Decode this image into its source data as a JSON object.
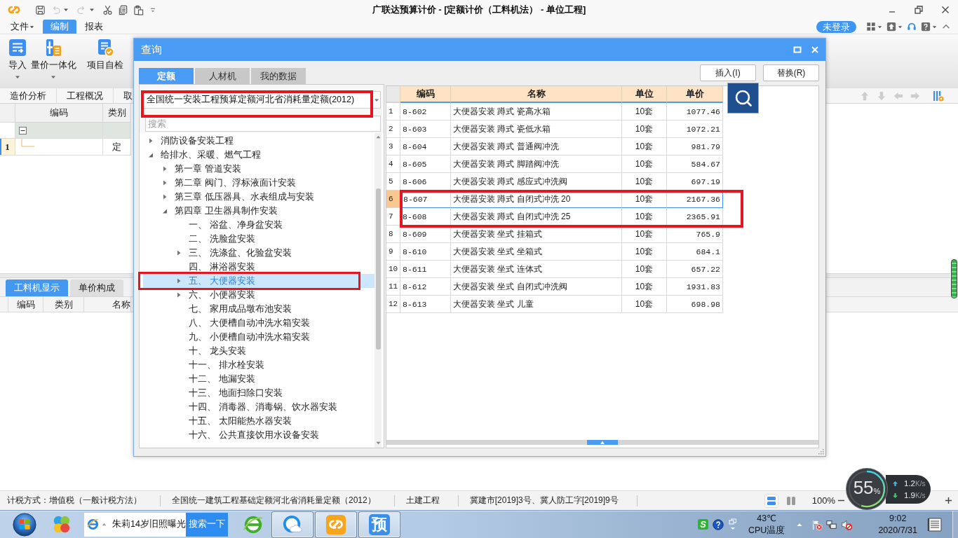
{
  "titlebar": {
    "title": "广联达预算计价 - [定额计价（工料机法） - 单位工程]",
    "quick_access": [
      {
        "kind": "save",
        "disabled": false,
        "menu": false
      },
      {
        "kind": "undo",
        "disabled": true,
        "menu": true
      },
      {
        "kind": "redo",
        "disabled": true,
        "menu": true
      },
      {
        "kind": "cut",
        "disabled": false,
        "menu": false
      },
      {
        "kind": "copy",
        "disabled": false,
        "menu": false
      },
      {
        "kind": "paste",
        "disabled": false,
        "menu": false
      },
      {
        "kind": "customize",
        "disabled": false,
        "menu": false
      }
    ]
  },
  "menu_bar": {
    "items": [
      {
        "label": "文件",
        "menu": true,
        "selected": false
      },
      {
        "label": "编制",
        "menu": false,
        "selected": true
      },
      {
        "label": "报表",
        "menu": false,
        "selected": false
      }
    ],
    "account": "未登录",
    "tools": [
      {
        "kind": "layout",
        "menu": true
      },
      {
        "kind": "upload",
        "menu": true
      },
      {
        "kind": "support",
        "menu": false
      },
      {
        "kind": "help",
        "menu": true
      },
      {
        "kind": "collapse",
        "menu": false
      }
    ]
  },
  "ribbon": [
    {
      "kind": "import",
      "label": "导入",
      "menu": true
    },
    {
      "kind": "pricing",
      "label": "量价一体化",
      "menu": true
    },
    {
      "kind": "check",
      "label": "项目自检",
      "menu": false
    }
  ],
  "view_tabs": [
    "造价分析",
    "工程概况",
    "取"
  ],
  "grid_tools": [
    {
      "kind": "up",
      "disabled": true
    },
    {
      "kind": "down",
      "disabled": true
    },
    {
      "kind": "left",
      "disabled": true
    },
    {
      "kind": "right",
      "disabled": true
    },
    {
      "kind": "settings",
      "disabled": false
    }
  ],
  "grid": {
    "columns": [
      "编码",
      "类别"
    ],
    "rows": [
      {
        "kind": "group",
        "expanded": true,
        "selected": false
      },
      {
        "kind": "item",
        "number": "1",
        "category": "定",
        "selected": true
      }
    ]
  },
  "lower_pane": {
    "tabs": [
      {
        "label": "工料机显示",
        "selected": true
      },
      {
        "label": "单价构成",
        "selected": false
      }
    ],
    "columns": [
      "编码",
      "类别",
      "名称"
    ]
  },
  "dialog": {
    "title": "查询",
    "tabs": [
      {
        "label": "定额",
        "selected": true
      },
      {
        "label": "人材机",
        "selected": false
      },
      {
        "label": "我的数据",
        "selected": false
      }
    ],
    "library": {
      "value": "全国统一安装工程预算定额河北省消耗量定额(2012)",
      "highlighted": true
    },
    "search": {
      "placeholder": "搜索"
    },
    "tree": [
      {
        "label": "消防设备安装工程",
        "expanded": false,
        "selected": false,
        "highlighted": false
      },
      {
        "label": "给排水、采暖、燃气工程",
        "expanded": true,
        "selected": false,
        "highlighted": false,
        "children": [
          {
            "label": "第一章 管道安装",
            "expanded": false,
            "selected": false,
            "highlighted": false
          },
          {
            "label": "第二章 阀门、浮标液面计安装",
            "expanded": false,
            "selected": false,
            "highlighted": false
          },
          {
            "label": "第三章 低压器具、水表组成与安装",
            "expanded": false,
            "selected": false,
            "highlighted": false
          },
          {
            "label": "第四章 卫生器具制作安装",
            "expanded": true,
            "selected": false,
            "highlighted": false,
            "children": [
              {
                "label": "一、 浴盆、净身盆安装",
                "selected": false,
                "highlighted": false
              },
              {
                "label": "二、 洗脸盆安装",
                "selected": false,
                "highlighted": false
              },
              {
                "label": "三、 洗涤盆、化验盆安装",
                "expanded": false,
                "selected": false,
                "highlighted": false
              },
              {
                "label": "四、 淋浴器安装",
                "selected": false,
                "highlighted": false
              },
              {
                "label": "五、 大便器安装",
                "expanded": false,
                "selected": true,
                "highlighted": true
              },
              {
                "label": "六、 小便器安装",
                "expanded": false,
                "selected": false,
                "highlighted": false
              },
              {
                "label": "七、 家用成品墩布池安装",
                "selected": false,
                "highlighted": false
              },
              {
                "label": "八、 大便槽自动冲洗水箱安装",
                "selected": false,
                "highlighted": false
              },
              {
                "label": "九、 小便槽自动冲洗水箱安装",
                "selected": false,
                "highlighted": false
              },
              {
                "label": "十、 龙头安装",
                "selected": false,
                "highlighted": false
              },
              {
                "label": "十一、 排水栓安装",
                "selected": false,
                "highlighted": false
              },
              {
                "label": "十二、 地漏安装",
                "selected": false,
                "highlighted": false
              },
              {
                "label": "十三、 地面扫除口安装",
                "selected": false,
                "highlighted": false
              },
              {
                "label": "十四、 消毒器、消毒锅、饮水器安装",
                "selected": false,
                "highlighted": false
              },
              {
                "label": "十五、 太阳能热水器安装",
                "selected": false,
                "highlighted": false
              },
              {
                "label": "十六、 公共直接饮用水设备安装",
                "selected": false,
                "highlighted": false
              }
            ]
          }
        ]
      }
    ],
    "buttons": [
      "插入(I)",
      "替换(R)"
    ],
    "table": {
      "columns": [
        "编码",
        "名称",
        "单位",
        "单价"
      ],
      "rows": [
        {
          "number": "1",
          "code": "8-602",
          "name": "大便器安装 蹲式 瓷高水箱",
          "unit": "10套",
          "price": "1077.46",
          "selected": false,
          "highlighted": false
        },
        {
          "number": "2",
          "code": "8-603",
          "name": "大便器安装 蹲式 瓷低水箱",
          "unit": "10套",
          "price": "1072.21",
          "selected": false,
          "highlighted": false
        },
        {
          "number": "3",
          "code": "8-604",
          "name": "大便器安装 蹲式 普通阀冲洗",
          "unit": "10套",
          "price": "981.79",
          "selected": false,
          "highlighted": false
        },
        {
          "number": "4",
          "code": "8-605",
          "name": "大便器安装 蹲式 脚踏阀冲洗",
          "unit": "10套",
          "price": "584.67",
          "selected": false,
          "highlighted": false
        },
        {
          "number": "5",
          "code": "8-606",
          "name": "大便器安装 蹲式 感应式冲洗阀",
          "unit": "10套",
          "price": "697.19",
          "selected": false,
          "highlighted": false
        },
        {
          "number": "6",
          "code": "8-607",
          "name": "大便器安装 蹲式 自闭式冲洗 20",
          "unit": "10套",
          "price": "2167.36",
          "selected": true,
          "highlighted": true
        },
        {
          "number": "7",
          "code": "8-608",
          "name": "大便器安装 蹲式 自闭式冲洗 25",
          "unit": "10套",
          "price": "2365.91",
          "selected": false,
          "highlighted": true
        },
        {
          "number": "8",
          "code": "8-609",
          "name": "大便器安装 坐式 挂箱式",
          "unit": "10套",
          "price": "765.9",
          "selected": false,
          "highlighted": false
        },
        {
          "number": "9",
          "code": "8-610",
          "name": "大便器安装 坐式 坐箱式",
          "unit": "10套",
          "price": "684.1",
          "selected": false,
          "highlighted": false
        },
        {
          "number": "10",
          "code": "8-611",
          "name": "大便器安装 坐式 连体式",
          "unit": "10套",
          "price": "657.22",
          "selected": false,
          "highlighted": false
        },
        {
          "number": "11",
          "code": "8-612",
          "name": "大便器安装 坐式 自闭式冲洗阀",
          "unit": "10套",
          "price": "1931.83",
          "selected": false,
          "highlighted": false
        },
        {
          "number": "12",
          "code": "8-613",
          "name": "大便器安装 坐式 儿童",
          "unit": "10套",
          "price": "698.98",
          "selected": false,
          "highlighted": false
        }
      ]
    }
  },
  "status_bar": {
    "items": [
      "计税方式：增值税（一般计税方法）",
      "全国统一建筑工程基础定额河北省消耗量定额（2012）",
      "土建工程",
      "冀建市[2019]3号、冀人防工字[2019]9号"
    ],
    "views": [
      {
        "kind": "rows",
        "selected": true
      },
      {
        "kind": "columns",
        "selected": false
      }
    ],
    "zoom": "100%"
  },
  "monitor": {
    "percent": "55",
    "unit": "%",
    "level": 0.55,
    "upload": {
      "value": "1.2",
      "unit": "K/s"
    },
    "download": {
      "value": "1.9",
      "unit": "K/s"
    }
  },
  "taskbar": {
    "apps": [
      {
        "kind": "orbs",
        "running": false
      },
      {
        "kind": "search"
      },
      {
        "kind": "browser",
        "running": false
      },
      {
        "kind": "cloud",
        "running": true
      },
      {
        "kind": "logo",
        "running": true
      },
      {
        "kind": "letter",
        "label": "预",
        "running": true
      }
    ],
    "search": {
      "headline": "朱莉14岁旧照曝光",
      "button": "搜索一下"
    },
    "tray": [
      {
        "kind": "ime",
        "label": "S"
      },
      {
        "kind": "help"
      },
      {
        "kind": "window"
      }
    ],
    "temperature": {
      "value": "43℃",
      "label": "CPU温度"
    },
    "notify": [
      {
        "kind": "expand"
      },
      {
        "kind": "flag",
        "alert": true
      },
      {
        "kind": "network"
      },
      {
        "kind": "volume",
        "muted": true
      }
    ],
    "clock": {
      "time": "9:02",
      "date": "2020/7/31"
    }
  }
}
